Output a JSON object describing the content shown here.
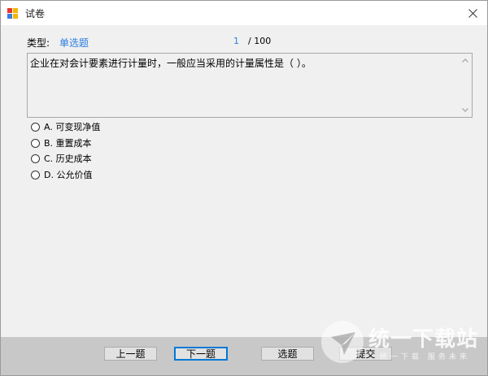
{
  "window": {
    "title": "试卷"
  },
  "question_info": {
    "type_label": "类型:",
    "type_value": "单选题",
    "current": "1",
    "total": "/ 100"
  },
  "question": {
    "text": "企业在对会计要素进行计量时，一般应当采用的计量属性是（   ）。"
  },
  "options": [
    {
      "label": "A. 可变现净值"
    },
    {
      "label": "B. 重置成本"
    },
    {
      "label": "C. 历史成本"
    },
    {
      "label": "D. 公允价值"
    }
  ],
  "buttons": {
    "prev": "上一题",
    "next": "下一题",
    "select": "选题",
    "submit": "提交"
  },
  "watermark": {
    "main": "统一下载站",
    "sub": "统一下载  服务未来"
  },
  "colors": {
    "accent_blue": "#2a7de1",
    "focus_blue": "#0078d7",
    "footer_gray": "#c8c8c8"
  }
}
